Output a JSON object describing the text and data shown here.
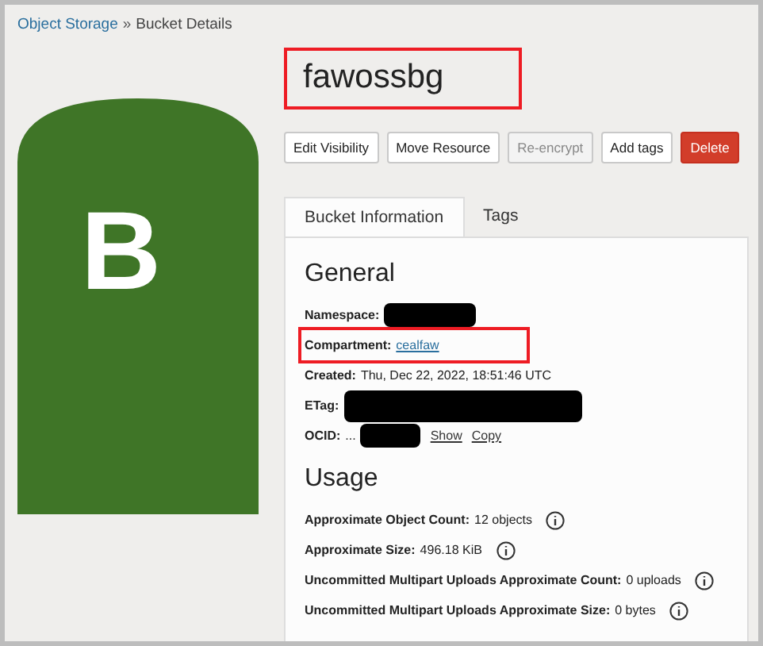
{
  "breadcrumb": [
    {
      "label": "Object Storage",
      "link": true
    },
    {
      "label": "Bucket Details",
      "link": false
    }
  ],
  "breadcrumb_separator": "»",
  "bucket_icon": {
    "letter": "B"
  },
  "title": {
    "text": "fawossbg",
    "highlighted": true
  },
  "buttons": [
    {
      "label": "Edit Visibility",
      "kind": "default",
      "disabled": false
    },
    {
      "label": "Move Resource",
      "kind": "default",
      "disabled": false
    },
    {
      "label": "Re-encrypt",
      "kind": "default",
      "disabled": true
    },
    {
      "label": "Add tags",
      "kind": "default",
      "disabled": false
    },
    {
      "label": "Delete",
      "kind": "danger",
      "disabled": false
    }
  ],
  "tabs": [
    {
      "label": "Bucket Information",
      "selected": true
    },
    {
      "label": "Tags",
      "selected": false
    }
  ],
  "general": {
    "heading": "General",
    "fields": [
      {
        "label": "Namespace:",
        "redacted": true,
        "highlighted": false
      },
      {
        "label": "Compartment:",
        "value": "cealfaw",
        "link": true,
        "highlighted": true
      },
      {
        "label": "Created:",
        "value": "Thu, Dec 22, 2022, 18:51:46 UTC",
        "highlighted": false
      },
      {
        "label": "ETag:",
        "redacted": true,
        "highlighted": false
      },
      {
        "label": "OCID:",
        "value": "...",
        "redacted": true,
        "actions": [
          "Show",
          "Copy"
        ],
        "highlighted": false
      }
    ]
  },
  "usage": {
    "heading": "Usage",
    "fields": [
      {
        "label": "Approximate Object Count:",
        "value": "12 objects"
      },
      {
        "label": "Approximate Size:",
        "value": "496.18 KiB"
      },
      {
        "label": "Uncommitted Multipart Uploads Approximate Count:",
        "value": "0 uploads"
      },
      {
        "label": "Uncommitted Multipart Uploads Approximate Size:",
        "value": "0 bytes"
      }
    ]
  }
}
